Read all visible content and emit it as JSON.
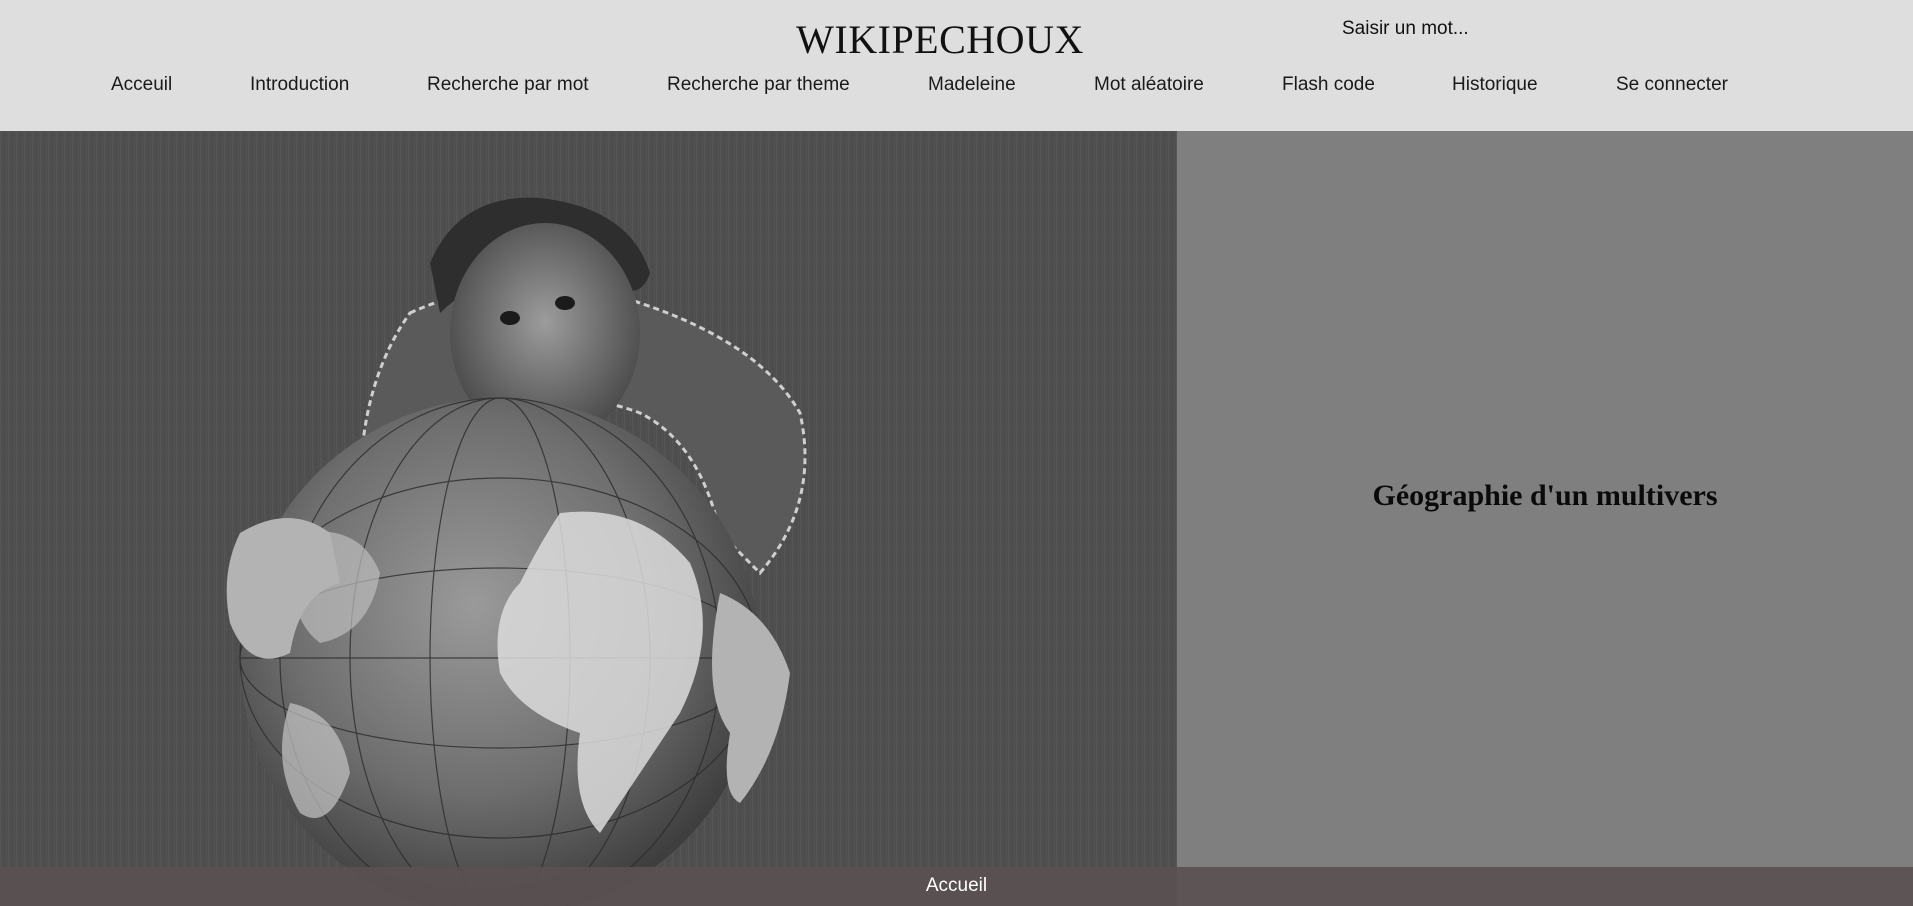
{
  "header": {
    "site_title": "WIKIPECHOUX",
    "search": {
      "placeholder": "Saisir un mot..."
    }
  },
  "nav": {
    "items": [
      {
        "label": "Acceuil"
      },
      {
        "label": "Introduction"
      },
      {
        "label": "Recherche par mot"
      },
      {
        "label": "Recherche par theme"
      },
      {
        "label": "Madeleine"
      },
      {
        "label": "Mot aléatoire"
      },
      {
        "label": "Flash code"
      },
      {
        "label": "Historique"
      },
      {
        "label": "Se connecter"
      }
    ]
  },
  "main": {
    "image_icon": "photo-man-kissing-globe",
    "heading": "Géographie d'un multivers"
  },
  "footer": {
    "link_label": "Accueil"
  },
  "colors": {
    "header_bg": "#dedede",
    "panel_bg": "#7f7f7f",
    "footer_bg": "#5a5052"
  }
}
